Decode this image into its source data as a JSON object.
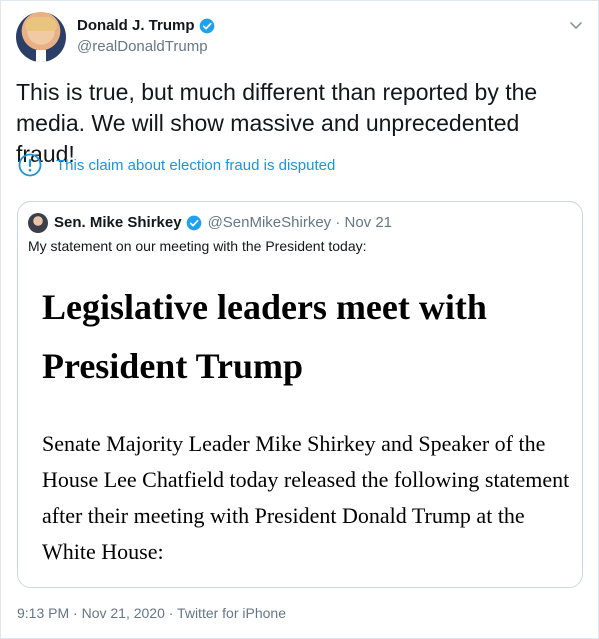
{
  "tweet": {
    "author_name": "Donald J. Trump",
    "author_handle": "@realDonaldTrump",
    "verified": true,
    "text": "This is true, but much different than reported by the media. We will show massive and unprecedented fraud!",
    "notice": "This claim about election fraud is disputed",
    "notice_color": "#1b95e0",
    "footer": "9:13 PM · Nov 21, 2020 · Twitter for iPhone"
  },
  "quoted": {
    "author_name": "Sen. Mike Shirkey",
    "author_meta": "@SenMikeShirkey · Nov 21",
    "verified": true,
    "text": "My statement on our meeting with the President today:",
    "image": {
      "headline": "Legislative leaders meet with President Trump",
      "body": "Senate Majority Leader Mike Shirkey and Speaker of the House Lee Chatfield today released the following statement after their meeting with President Donald Trump at the White House:"
    }
  },
  "icons": {
    "verified": "verified-badge-icon",
    "menu": "chevron-down-icon",
    "notice": "exclamation-circle-icon"
  },
  "colors": {
    "brand_blue": "#1da1f2",
    "text": "#14171a",
    "secondary": "#657786",
    "border": "#e1e8ed"
  }
}
